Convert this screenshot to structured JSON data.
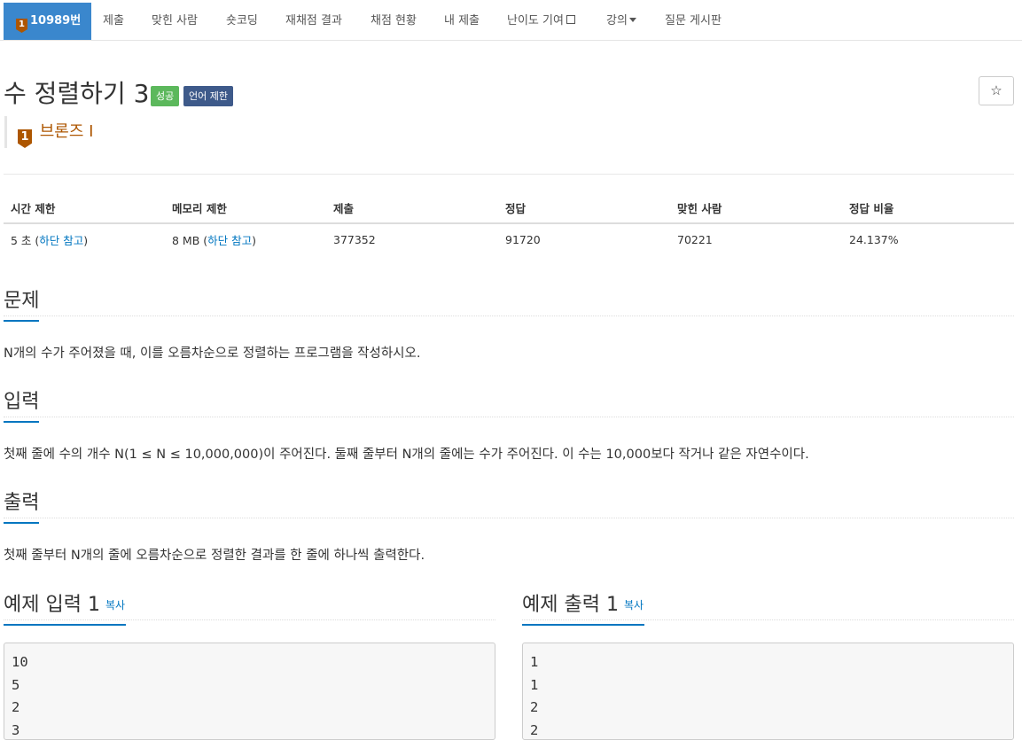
{
  "nav": {
    "problem_id": "10989번",
    "tier_num": "1",
    "items": [
      "제출",
      "맞힌 사람",
      "숏코딩",
      "재채점 결과",
      "채점 현황",
      "내 제출",
      "난이도 기여",
      "강의",
      "질문 게시판"
    ]
  },
  "problem": {
    "title": "수 정렬하기 3",
    "label_success": "성공",
    "label_lang": "언어 제한",
    "star": "☆",
    "tier_num": "1",
    "tier_name": "브론즈 I"
  },
  "info_table": {
    "headers": [
      "시간 제한",
      "메모리 제한",
      "제출",
      "정답",
      "맞힌 사람",
      "정답 비율"
    ],
    "time_value": "5 초 (",
    "time_link": "하단 참고",
    "time_close": ")",
    "memory_value": "8 MB (",
    "memory_link": "하단 참고",
    "memory_close": ")",
    "submissions": "377352",
    "accepted": "91720",
    "solvers": "70221",
    "ratio": "24.137%"
  },
  "sections": {
    "problem_title": "문제",
    "problem_text": "N개의 수가 주어졌을 때, 이를 오름차순으로 정렬하는 프로그램을 작성하시오.",
    "input_title": "입력",
    "input_text": "첫째 줄에 수의 개수 N(1 ≤ N ≤ 10,000,000)이 주어진다. 둘째 줄부터 N개의 줄에는 수가 주어진다. 이 수는 10,000보다 작거나 같은 자연수이다.",
    "output_title": "출력",
    "output_text": "첫째 줄부터 N개의 줄에 오름차순으로 정렬한 결과를 한 줄에 하나씩 출력한다."
  },
  "samples": {
    "input_title": "예제 입력 1",
    "output_title": "예제 출력 1",
    "copy_label": "복사",
    "input_lines": [
      "10",
      "5",
      "2",
      "3"
    ],
    "output_lines": [
      "1",
      "1",
      "2",
      "2"
    ]
  },
  "colors": {
    "nav_active": "#3a87cd",
    "tier_bronze": "#ad5600",
    "label_success": "#5cb85c",
    "label_lang": "#3e5a8a",
    "link": "#0076c0"
  }
}
